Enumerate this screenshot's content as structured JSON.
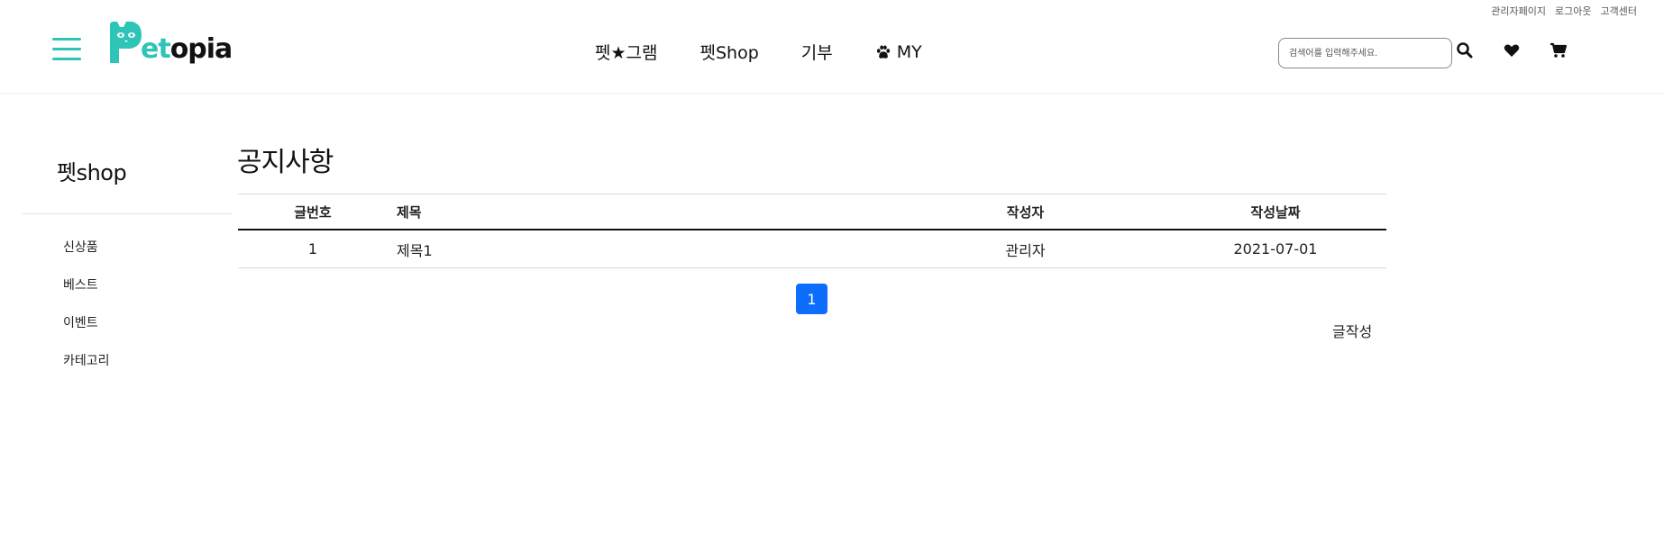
{
  "utility_links": [
    "관리자페이지",
    "로그아웃",
    "고객센터"
  ],
  "logo": {
    "letter": "P",
    "part1": "et",
    "part2": "opia"
  },
  "nav": [
    {
      "label": "펫★그램"
    },
    {
      "label": "펫Shop"
    },
    {
      "label": "기부"
    },
    {
      "label": "MY",
      "icon": "paw-icon"
    }
  ],
  "search": {
    "placeholder": "검색어를 입력해주세요.",
    "value": ""
  },
  "header_icons": [
    "search-icon",
    "heart-icon",
    "cart-icon"
  ],
  "sidebar": {
    "title": "펫shop",
    "items": [
      "신상품",
      "베스트",
      "이벤트",
      "카테고리"
    ]
  },
  "main": {
    "title": "공지사항",
    "columns": [
      "글번호",
      "제목",
      "작성자",
      "작성날짜"
    ],
    "rows": [
      {
        "no": "1",
        "subject": "제목1",
        "author": "관리자",
        "date": "2021-07-01"
      }
    ],
    "pagination": {
      "current": "1"
    },
    "write_label": "글작성"
  },
  "colors": {
    "brand": "#2ec4b6",
    "page_active": "#0d6efd",
    "text": "#111111"
  }
}
